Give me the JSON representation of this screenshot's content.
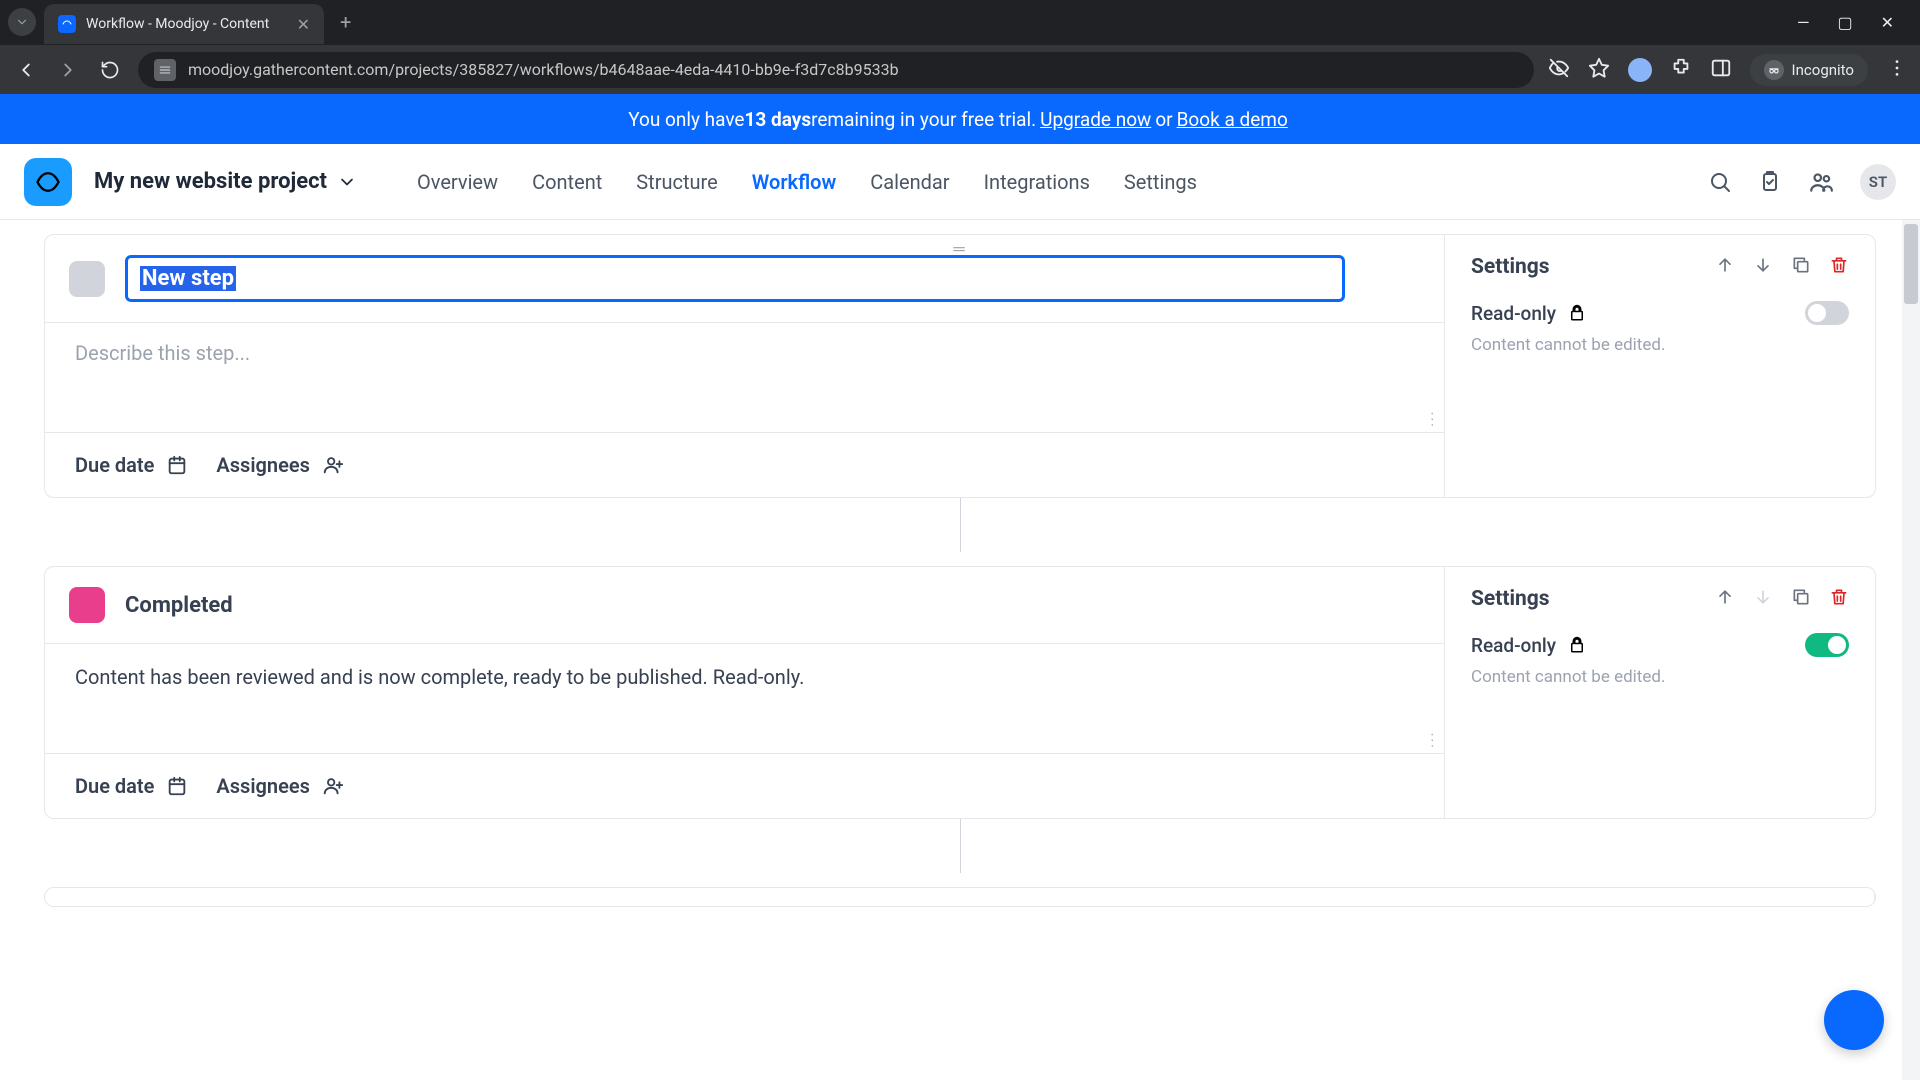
{
  "browser": {
    "tab_title": "Workflow - Moodjoy - Content",
    "url": "moodjoy.gathercontent.com/projects/385827/workflows/b4648aae-4eda-4410-bb9e-f3d7c8b9533b",
    "incognito_label": "Incognito"
  },
  "banner": {
    "prefix": "You only have ",
    "days": "13 days",
    "middle": " remaining in your free trial. ",
    "upgrade": "Upgrade now",
    "or": " or ",
    "demo": "Book a demo"
  },
  "header": {
    "project_name": "My new website project",
    "nav": [
      "Overview",
      "Content",
      "Structure",
      "Workflow",
      "Calendar",
      "Integrations",
      "Settings"
    ],
    "active_nav": "Workflow",
    "avatar": "ST"
  },
  "steps": [
    {
      "title": "New step",
      "editing": true,
      "color": "gray",
      "description": "",
      "desc_placeholder": "Describe this step...",
      "readonly": false
    },
    {
      "title": "Completed",
      "editing": false,
      "color": "pink",
      "description": "Content has been reviewed and is now complete, ready to be published. Read-only.",
      "desc_placeholder": "",
      "readonly": true
    }
  ],
  "labels": {
    "settings": "Settings",
    "readonly": "Read-only",
    "readonly_hint": "Content cannot be edited.",
    "due_date": "Due date",
    "assignees": "Assignees"
  }
}
